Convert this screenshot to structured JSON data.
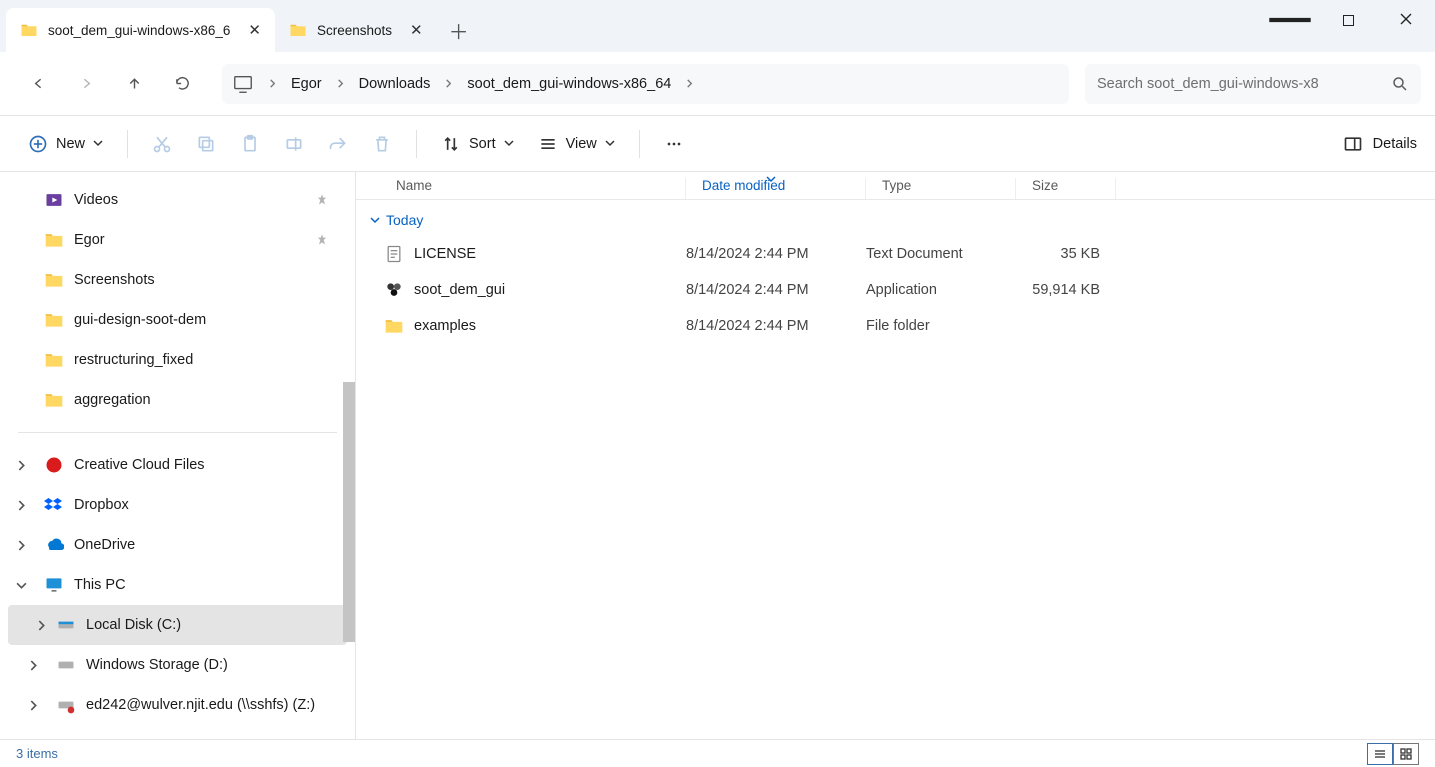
{
  "tabs": [
    {
      "label": "soot_dem_gui-windows-x86_6"
    },
    {
      "label": "Screenshots"
    }
  ],
  "breadcrumb": [
    "Egor",
    "Downloads",
    "soot_dem_gui-windows-x86_64"
  ],
  "search": {
    "placeholder": "Search soot_dem_gui-windows-x8"
  },
  "toolbar": {
    "new": "New",
    "sort": "Sort",
    "view": "View",
    "details": "Details"
  },
  "columns": {
    "name": "Name",
    "date": "Date modified",
    "type": "Type",
    "size": "Size"
  },
  "group": "Today",
  "files": [
    {
      "name": "LICENSE",
      "date": "8/14/2024 2:44 PM",
      "type": "Text Document",
      "size": "35 KB",
      "icon": "text"
    },
    {
      "name": "soot_dem_gui",
      "date": "8/14/2024 2:44 PM",
      "type": "Application",
      "size": "59,914 KB",
      "icon": "app"
    },
    {
      "name": "examples",
      "date": "8/14/2024 2:44 PM",
      "type": "File folder",
      "size": "",
      "icon": "folder"
    }
  ],
  "sidebar": {
    "quick": [
      {
        "label": "Videos",
        "icon": "video",
        "pinned": true
      },
      {
        "label": "Egor",
        "icon": "folder",
        "pinned": true
      },
      {
        "label": "Screenshots",
        "icon": "folder"
      },
      {
        "label": "gui-design-soot-dem",
        "icon": "folder"
      },
      {
        "label": "restructuring_fixed",
        "icon": "folder"
      },
      {
        "label": "aggregation",
        "icon": "folder"
      }
    ],
    "roots": [
      {
        "label": "Creative Cloud Files",
        "icon": "cc",
        "chev": "right"
      },
      {
        "label": "Dropbox",
        "icon": "dropbox",
        "chev": "right"
      },
      {
        "label": "OneDrive",
        "icon": "onedrive",
        "chev": "right"
      },
      {
        "label": "This PC",
        "icon": "pc",
        "chev": "down"
      }
    ],
    "drives": [
      {
        "label": "Local Disk (C:)",
        "icon": "disk",
        "selected": true
      },
      {
        "label": "Windows Storage (D:)",
        "icon": "disk"
      },
      {
        "label": "ed242@wulver.njit.edu (\\\\sshfs) (Z:)",
        "icon": "netdisk"
      }
    ]
  },
  "status": "3 items"
}
